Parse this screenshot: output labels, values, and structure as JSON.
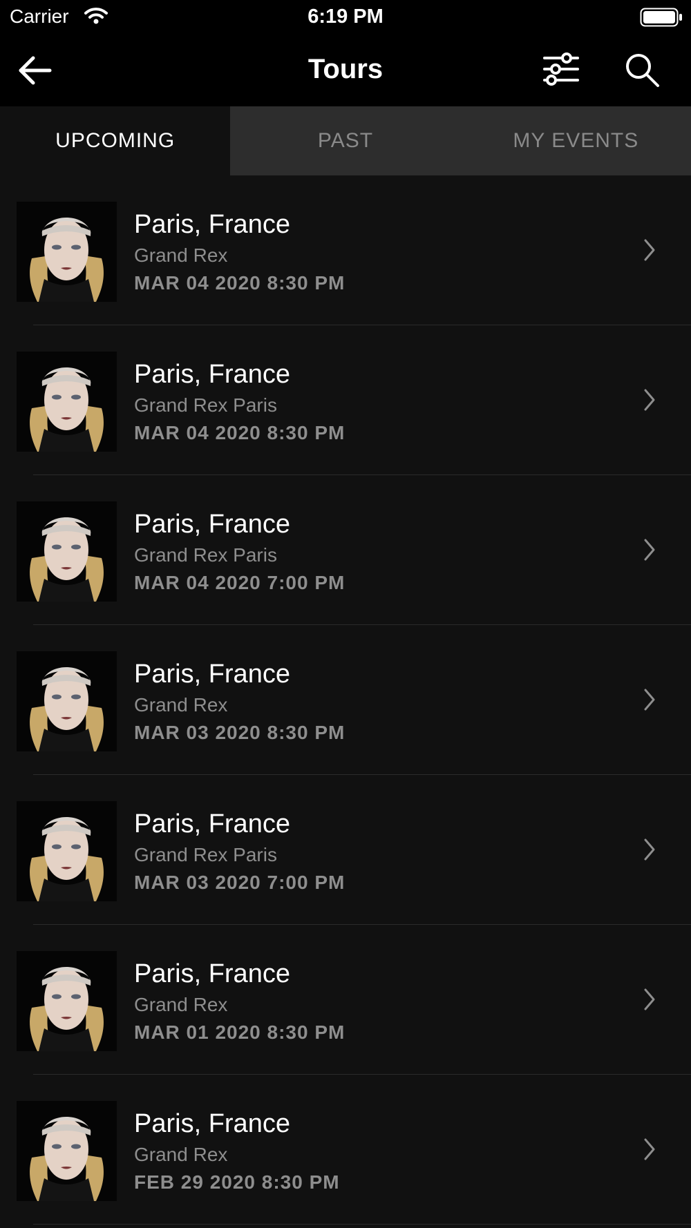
{
  "status": {
    "carrier": "Carrier",
    "time": "6:19 PM"
  },
  "nav": {
    "title": "Tours"
  },
  "tabs": [
    {
      "label": "UPCOMING",
      "active": true
    },
    {
      "label": "PAST",
      "active": false
    },
    {
      "label": "MY EVENTS",
      "active": false
    }
  ],
  "events": [
    {
      "city": "Paris, France",
      "venue": "Grand Rex",
      "date": "MAR 04 2020 8:30 PM"
    },
    {
      "city": "Paris, France",
      "venue": "Grand Rex Paris",
      "date": "MAR 04 2020 8:30 PM"
    },
    {
      "city": "Paris, France",
      "venue": "Grand Rex Paris",
      "date": "MAR 04 2020 7:00 PM"
    },
    {
      "city": "Paris, France",
      "venue": "Grand Rex",
      "date": "MAR 03 2020 8:30 PM"
    },
    {
      "city": "Paris, France",
      "venue": "Grand Rex Paris",
      "date": "MAR 03 2020 7:00 PM"
    },
    {
      "city": "Paris, France",
      "venue": "Grand Rex",
      "date": "MAR 01 2020 8:30 PM"
    },
    {
      "city": "Paris, France",
      "venue": "Grand Rex",
      "date": "FEB 29 2020 8:30 PM"
    }
  ],
  "colors": {
    "background": "#111111",
    "bar": "#000000",
    "inactive_tab": "#2d2d2d",
    "muted_text": "#8e8e8e"
  }
}
